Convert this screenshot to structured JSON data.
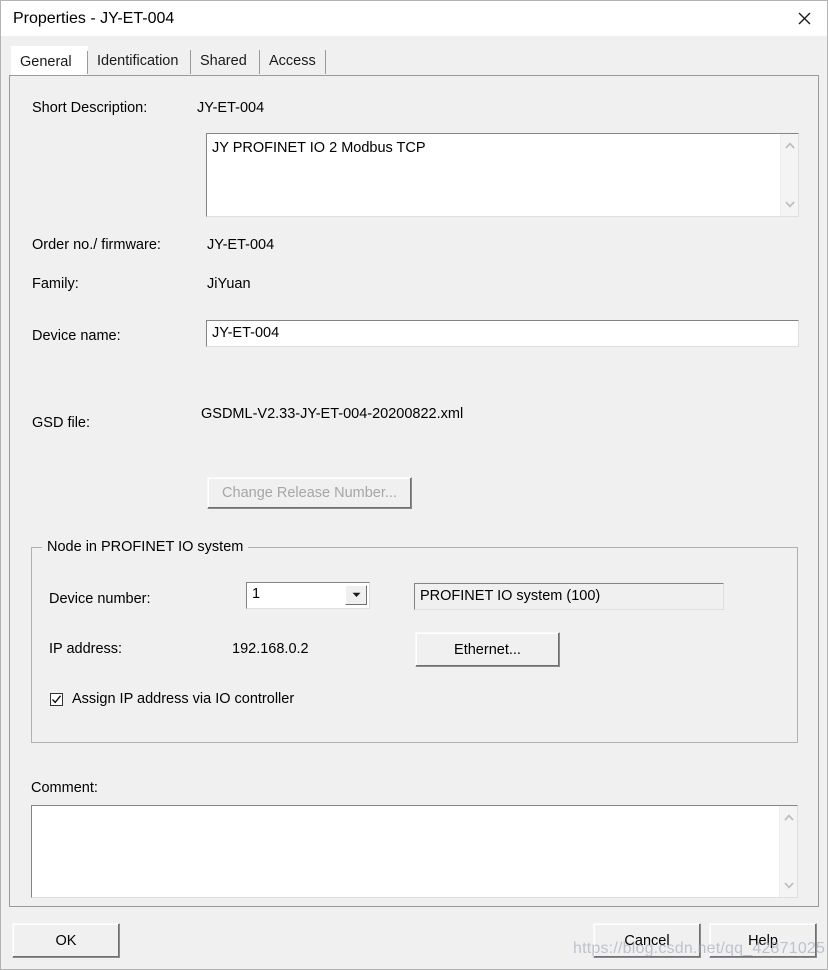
{
  "window": {
    "title": "Properties - JY-ET-004",
    "close_icon": "close-icon"
  },
  "tabs": [
    {
      "label": "General",
      "selected": true
    },
    {
      "label": "Identification",
      "selected": false
    },
    {
      "label": "Shared",
      "selected": false
    },
    {
      "label": "Access",
      "selected": false
    }
  ],
  "general": {
    "short_description_label": "Short Description:",
    "short_description_value": "JY-ET-004",
    "description_text": "JY PROFINET IO 2 Modbus TCP",
    "order_firmware_label": "Order no./ firmware:",
    "order_firmware_value": "JY-ET-004",
    "family_label": "Family:",
    "family_value": "JiYuan",
    "device_name_label": "Device name:",
    "device_name_value": "JY-ET-004",
    "gsd_file_label": "GSD file:",
    "gsd_file_value": "GSDML-V2.33-JY-ET-004-20200822.xml",
    "change_release_button": "Change Release Number...",
    "change_release_enabled": false
  },
  "node_group": {
    "title": "Node in PROFINET IO system",
    "device_number_label": "Device number:",
    "device_number_value": "1",
    "device_number_options": [
      "1"
    ],
    "io_system_value": "PROFINET IO system (100)",
    "ip_address_label": "IP address:",
    "ip_address_value": "192.168.0.2",
    "ethernet_button": "Ethernet...",
    "assign_ip_label": "Assign IP address via IO controller",
    "assign_ip_checked": true
  },
  "comment": {
    "label": "Comment:",
    "value": ""
  },
  "footer": {
    "ok_label": "OK",
    "cancel_label": "Cancel",
    "help_label": "Help"
  },
  "watermark": {
    "text": "https://blog.csdn.net/qq_42871025"
  }
}
